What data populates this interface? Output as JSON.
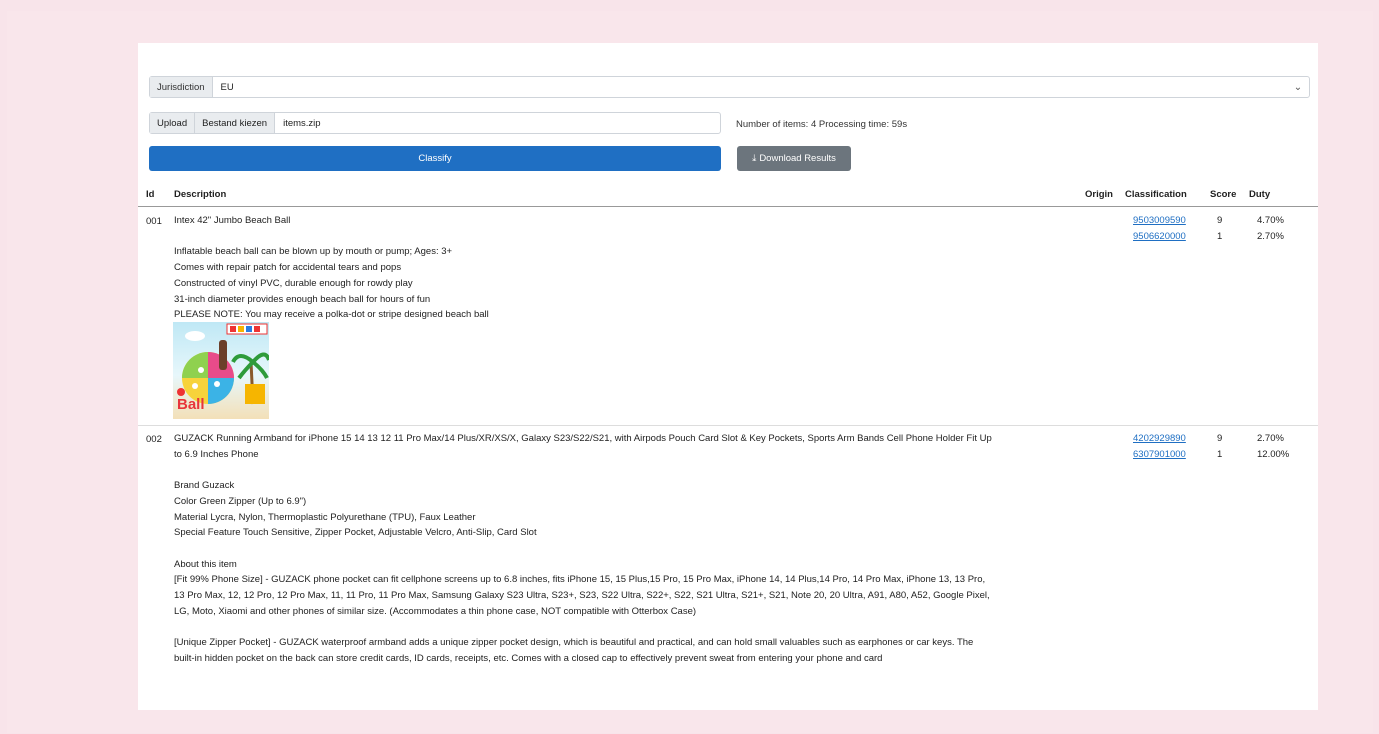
{
  "controls": {
    "jurisdiction_label": "Jurisdiction",
    "jurisdiction_value": "EU",
    "upload_label": "Upload",
    "choose_file_label": "Bestand kiezen",
    "file_name": "items.zip",
    "info": "Number of items: 4 Processing time: 59s",
    "classify_label": "Classify",
    "download_label": "Download Results"
  },
  "table": {
    "headers": {
      "id": "Id",
      "description": "Description",
      "origin": "Origin",
      "classification": "Classification",
      "score": "Score",
      "duty": "Duty"
    },
    "rows": [
      {
        "id": "001",
        "lines": [
          "Intex 42\" Jumbo Beach Ball",
          "",
          "Inflatable beach ball can be blown up by mouth or pump; Ages: 3+",
          "Comes with repair patch for accidental tears and pops",
          "Constructed of vinyl PVC, durable enough for rowdy play",
          "31-inch diameter provides enough beach ball for hours of fun",
          "PLEASE NOTE: You may receive a polka-dot or stripe designed beach ball"
        ],
        "image_text": "Ball",
        "classifications": [
          "9503009590",
          "9506620000"
        ],
        "scores": [
          "9",
          "1"
        ],
        "duties": [
          "4.70%",
          "2.70%"
        ]
      },
      {
        "id": "002",
        "lines": [
          "GUZACK Running Armband for iPhone 15 14 13 12 11 Pro Max/14 Plus/XR/XS/X, Galaxy S23/S22/S21, with Airpods Pouch Card Slot & Key Pockets, Sports Arm Bands Cell Phone Holder Fit Up",
          "to 6.9 Inches Phone",
          "",
          "Brand Guzack",
          "Color Green Zipper (Up to 6.9\")",
          "Material Lycra, Nylon, Thermoplastic Polyurethane (TPU), Faux Leather",
          "Special Feature Touch Sensitive, Zipper Pocket, Adjustable Velcro, Anti-Slip, Card Slot",
          "",
          "About this item",
          "[Fit 99% Phone Size] - GUZACK phone pocket can fit cellphone screens up to 6.8 inches, fits iPhone 15, 15 Plus,15 Pro, 15 Pro Max, iPhone 14, 14 Plus,14 Pro, 14 Pro Max, iPhone 13, 13 Pro,",
          "13 Pro Max, 12, 12 Pro, 12 Pro Max, 11, 11 Pro, 11 Pro Max, Samsung Galaxy S23 Ultra, S23+, S23, S22 Ultra, S22+, S22, S21 Ultra, S21+, S21, Note 20, 20 Ultra, A91, A80, A52, Google Pixel,",
          "LG, Moto, Xiaomi and other phones of similar size. (Accommodates a thin phone case, NOT compatible with Otterbox Case)",
          "",
          "[Unique Zipper Pocket] - GUZACK waterproof armband adds a unique zipper pocket design, which is beautiful and practical, and can hold small valuables such as earphones or car keys. The",
          "built-in hidden pocket on the back can store credit cards, ID cards, receipts, etc. Comes with a closed cap to effectively prevent sweat from entering your phone and card"
        ],
        "classifications": [
          "4202929890",
          "6307901000"
        ],
        "scores": [
          "9",
          "1"
        ],
        "duties": [
          "2.70%",
          "12.00%"
        ]
      }
    ]
  }
}
